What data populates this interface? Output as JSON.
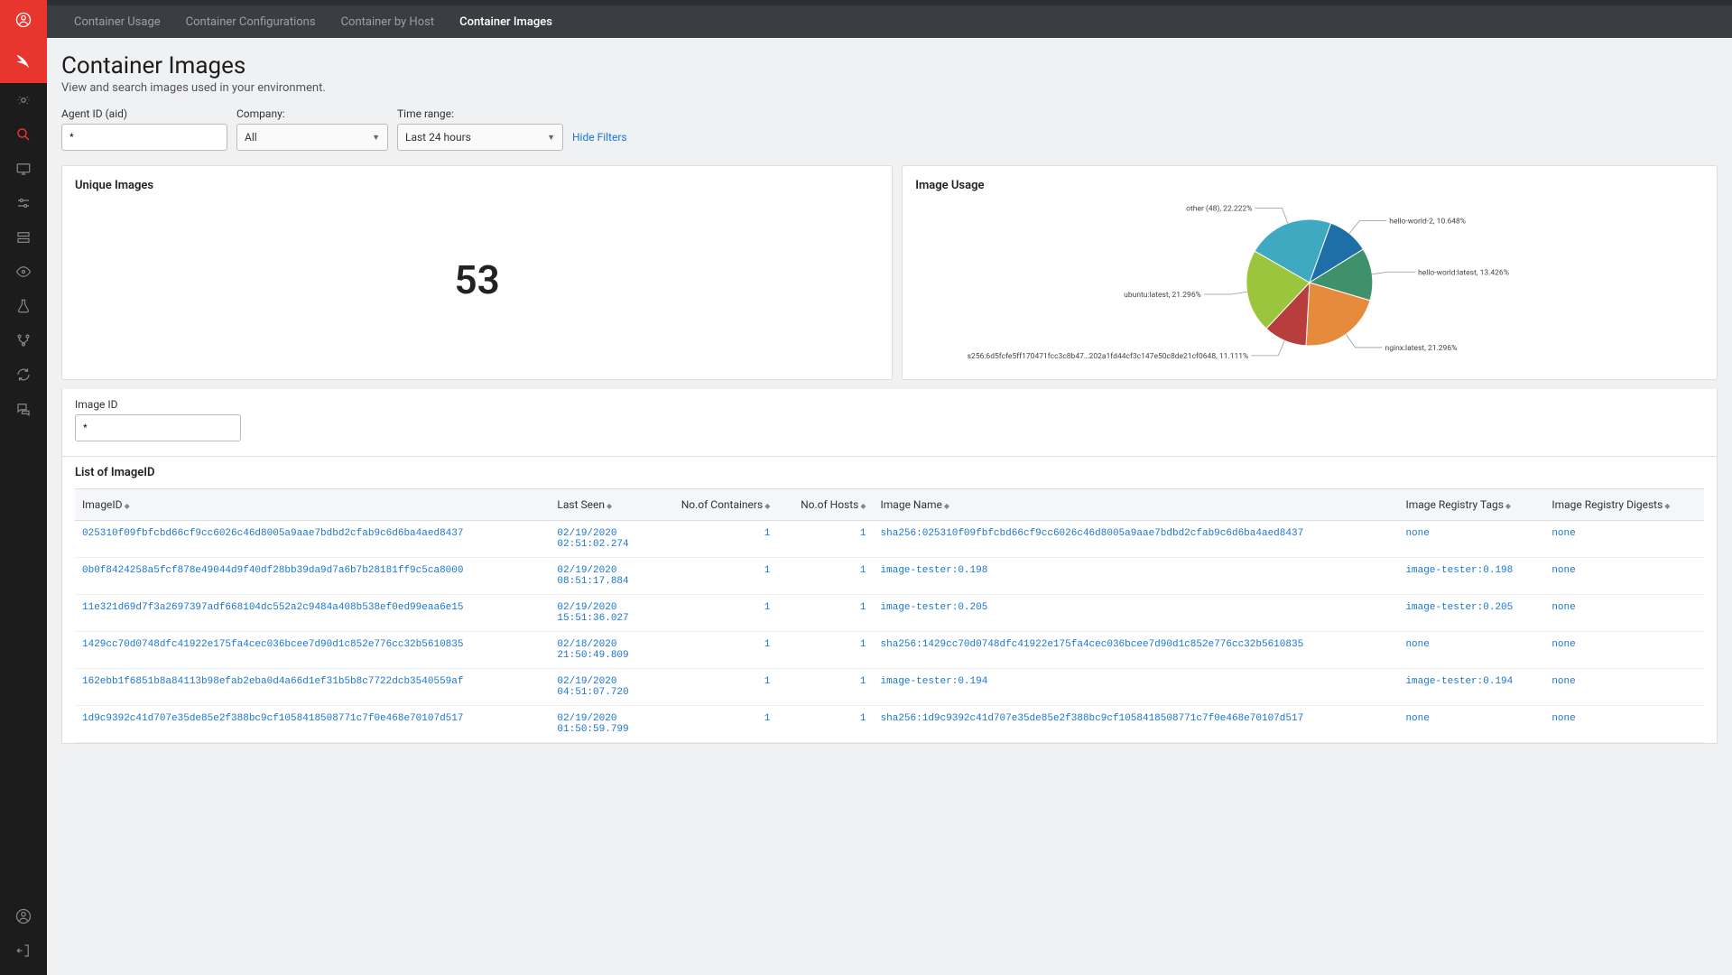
{
  "tabs": [
    "Container Usage",
    "Container Configurations",
    "Container by Host",
    "Container Images"
  ],
  "active_tab": 3,
  "page": {
    "title": "Container Images",
    "subtitle": "View and search images used in your environment."
  },
  "filters": {
    "agent": {
      "label": "Agent ID (aid)",
      "value": "*"
    },
    "company": {
      "label": "Company:",
      "value": "All"
    },
    "timerange": {
      "label": "Time range:",
      "value": "Last 24 hours"
    },
    "hide": "Hide Filters"
  },
  "imageid_filter": {
    "label": "Image ID",
    "value": "*"
  },
  "cards": {
    "unique": {
      "title": "Unique Images",
      "value": "53"
    },
    "usage": {
      "title": "Image Usage"
    }
  },
  "chart_data": {
    "type": "pie",
    "series": [
      {
        "name": "other (48)",
        "value": 22.222,
        "color": "#3ea9c1",
        "label": "other (48), 22.222%"
      },
      {
        "name": "hello-world-2",
        "value": 10.648,
        "color": "#1e6fa7",
        "label": "hello-world-2, 10.648%"
      },
      {
        "name": "hello-world:latest",
        "value": 13.426,
        "color": "#3f916b",
        "label": "hello-world:latest, 13.426%"
      },
      {
        "name": "nginx:latest",
        "value": 21.296,
        "color": "#e68a3b",
        "label": "nginx:latest, 21.296%"
      },
      {
        "name": "sha256:6d5fcfe5ff170471fcc3c8b47…202a1fd44cf3c147e50c8de21cf0648",
        "value": 11.111,
        "color": "#b83e3e",
        "label": "s256:6d5fcfe5ff170471fcc3c8b47…202a1fd44cf3c147e50c8de21cf0648, 11.111%"
      },
      {
        "name": "ubuntu:latest",
        "value": 21.296,
        "color": "#9bc53d",
        "label": "ubuntu:latest, 21.296%"
      }
    ]
  },
  "table": {
    "title": "List of ImageID",
    "columns": [
      "ImageID",
      "Last Seen",
      "No.of Containers",
      "No.of Hosts",
      "Image Name",
      "Image Registry Tags",
      "Image Registry Digests"
    ],
    "rows": [
      {
        "id": "025310f09fbfcbd66cf9cc6026c46d8005a9aae7bdbd2cfab9c6d6ba4aed8437",
        "last": "02/19/2020 02:51:02.274",
        "containers": "1",
        "hosts": "1",
        "name": "sha256:025310f09fbfcbd66cf9cc6026c46d8005a9aae7bdbd2cfab9c6d6ba4aed8437",
        "tags": "none",
        "digests": "none"
      },
      {
        "id": "0b0f8424258a5fcf878e49044d9f40df28bb39da9d7a6b7b28181ff9c5ca8000",
        "last": "02/19/2020 08:51:17.884",
        "containers": "1",
        "hosts": "1",
        "name": "image-tester:0.198",
        "tags": "image-tester:0.198",
        "digests": "none"
      },
      {
        "id": "11e321d69d7f3a2697397adf668104dc552a2c9484a408b538ef0ed99eaa6e15",
        "last": "02/19/2020 15:51:36.027",
        "containers": "1",
        "hosts": "1",
        "name": "image-tester:0.205",
        "tags": "image-tester:0.205",
        "digests": "none"
      },
      {
        "id": "1429cc70d0748dfc41922e175fa4cec036bcee7d90d1c852e776cc32b5610835",
        "last": "02/18/2020 21:50:49.809",
        "containers": "1",
        "hosts": "1",
        "name": "sha256:1429cc70d0748dfc41922e175fa4cec036bcee7d90d1c852e776cc32b5610835",
        "tags": "none",
        "digests": "none"
      },
      {
        "id": "162ebb1f6851b8a84113b98efab2eba0d4a66d1ef31b5b8c7722dcb3540559af",
        "last": "02/19/2020 04:51:07.720",
        "containers": "1",
        "hosts": "1",
        "name": "image-tester:0.194",
        "tags": "image-tester:0.194",
        "digests": "none"
      },
      {
        "id": "1d9c9392c41d707e35de85e2f388bc9cf1058418508771c7f0e468e70107d517",
        "last": "02/19/2020 01:50:59.799",
        "containers": "1",
        "hosts": "1",
        "name": "sha256:1d9c9392c41d707e35de85e2f388bc9cf1058418508771c7f0e468e70107d517",
        "tags": "none",
        "digests": "none"
      }
    ]
  }
}
